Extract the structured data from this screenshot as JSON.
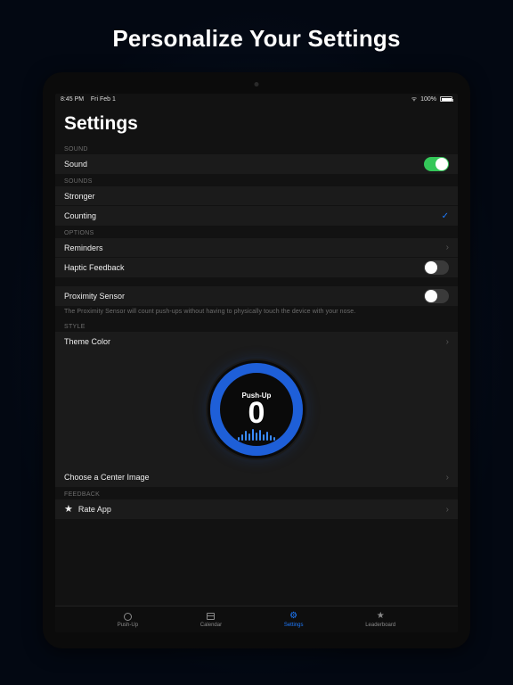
{
  "headline": "Personalize Your Settings",
  "statusbar": {
    "time": "8:45 PM",
    "date": "Fri Feb 1",
    "battery": "100%"
  },
  "title": "Settings",
  "sections": {
    "sound": {
      "header": "SOUND",
      "row_label": "Sound",
      "on": true
    },
    "sounds": {
      "header": "SOUNDS",
      "items": [
        "Stronger",
        "Counting"
      ],
      "selected": 1
    },
    "options": {
      "header": "OPTIONS",
      "reminders": "Reminders",
      "haptic": "Haptic Feedback",
      "haptic_on": false
    },
    "proximity": {
      "label": "Proximity Sensor",
      "on": false,
      "note": "The Proximity Sensor will count push-ups without having to physically touch the device with your nose."
    },
    "style": {
      "header": "STYLE",
      "theme": "Theme Color",
      "choose": "Choose a Center Image"
    },
    "dial": {
      "label": "Push-Up",
      "value": "0"
    },
    "feedback": {
      "header": "FEEDBACK",
      "rate": "Rate App"
    }
  },
  "tabs": [
    "Push-Up",
    "Calendar",
    "Settings",
    "Leaderboard"
  ],
  "active_tab": 2
}
